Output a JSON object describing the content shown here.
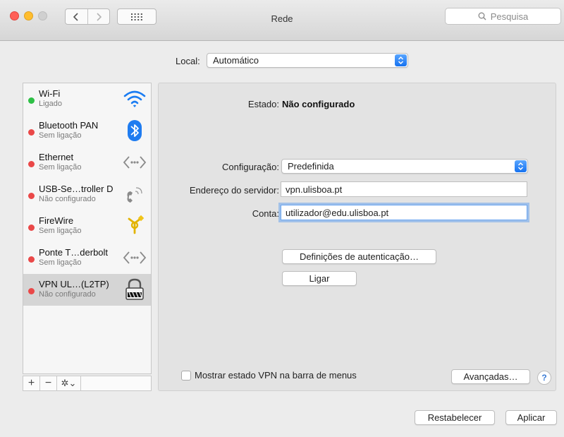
{
  "window": {
    "title": "Rede",
    "search_placeholder": "Pesquisa"
  },
  "location": {
    "label": "Local:",
    "value": "Automático"
  },
  "services": [
    {
      "name": "Wi-Fi",
      "status": "Ligado",
      "status_color": "green",
      "icon": "wifi-icon"
    },
    {
      "name": "Bluetooth PAN",
      "status": "Sem ligação",
      "status_color": "red",
      "icon": "bluetooth-icon"
    },
    {
      "name": "Ethernet",
      "status": "Sem ligação",
      "status_color": "red",
      "icon": "ethernet-icon"
    },
    {
      "name": "USB-Se…troller D",
      "status": "Não configurado",
      "status_color": "red",
      "icon": "phone-icon"
    },
    {
      "name": "FireWire",
      "status": "Sem ligação",
      "status_color": "red",
      "icon": "firewire-icon"
    },
    {
      "name": "Ponte T…derbolt",
      "status": "Sem ligação",
      "status_color": "red",
      "icon": "thunderbolt-bridge-icon"
    },
    {
      "name": "VPN UL…(L2TP)",
      "status": "Não configurado",
      "status_color": "red",
      "icon": "vpn-lock-icon",
      "selected": true
    }
  ],
  "sidebar_toolbar": {
    "add": "+",
    "remove": "−",
    "gear": "✲⌄"
  },
  "detail": {
    "state_label": "Estado:",
    "state_value": "Não configurado",
    "config_label": "Configuração:",
    "config_value": "Predefinida",
    "server_label": "Endereço do servidor:",
    "server_value": "vpn.ulisboa.pt",
    "account_label": "Conta:",
    "account_value": "utilizador@edu.ulisboa.pt",
    "auth_button": "Definições de autenticação…",
    "connect_button": "Ligar",
    "show_vpn_label": "Mostrar estado VPN na barra de menus",
    "advanced_button": "Avançadas…",
    "help": "?"
  },
  "footer": {
    "revert_button": "Restabelecer",
    "apply_button": "Aplicar"
  },
  "colors": {
    "accent": "#1672f0",
    "status_green": "#2ec046",
    "status_red": "#ea4848"
  }
}
